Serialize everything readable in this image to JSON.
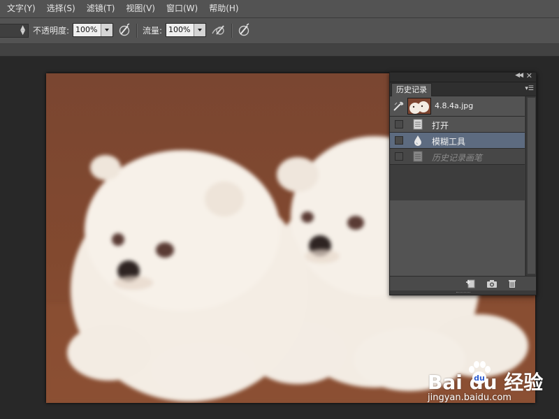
{
  "menu": {
    "items": [
      {
        "label": "文字(Y)"
      },
      {
        "label": "选择(S)"
      },
      {
        "label": "滤镜(T)"
      },
      {
        "label": "视图(V)"
      },
      {
        "label": "窗口(W)"
      },
      {
        "label": "帮助(H)"
      }
    ]
  },
  "options": {
    "opacity_label": "不透明度:",
    "opacity_value": "100%",
    "flow_label": "流量:",
    "flow_value": "100%",
    "icons": [
      "pressure-opacity-icon",
      "airbrush-icon",
      "pressure-size-icon"
    ]
  },
  "history_panel": {
    "tab_label": "历史记录",
    "snapshot_name": "4.8.4a.jpg",
    "steps": [
      {
        "label": "打开",
        "icon": "document-icon",
        "state": "normal"
      },
      {
        "label": "模糊工具",
        "icon": "blur-drop-icon",
        "state": "selected"
      },
      {
        "label": "历史记录画笔",
        "icon": "document-icon",
        "state": "undone"
      }
    ],
    "footer_icons": [
      "new-document-from-state-icon",
      "camera-snapshot-icon",
      "trash-icon"
    ]
  },
  "watermark": {
    "logo_text": "Bai  du 经验",
    "url": "jingyan.baidu.com"
  },
  "colors": {
    "canvas_background": "#7e4730",
    "selected_row": "#5d6b80"
  }
}
